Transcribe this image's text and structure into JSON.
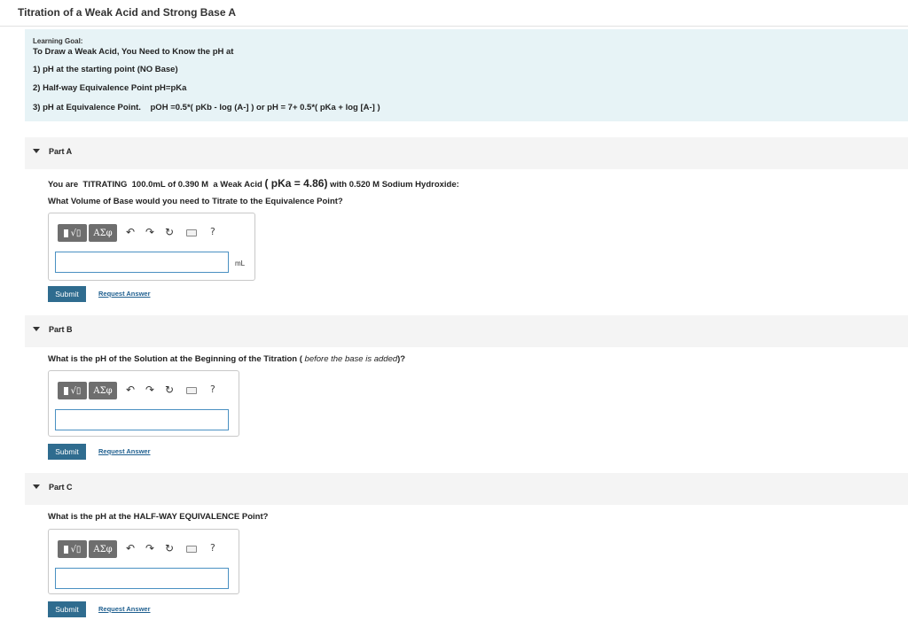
{
  "page": {
    "title": "Titration of a Weak Acid and Strong Base A"
  },
  "learning_goal": {
    "label": "Learning Goal:",
    "lines": [
      "To Draw a Weak Acid, You Need to Know the pH at",
      "1) pH at the starting point (NO Base)",
      "2) Half-way Equivalence Point pH=pKa",
      "3) pH at Equivalence Point.    pOH =0.5*( pKb - log (A-] ) or pH = 7+ 0.5*( pKa + log [A-] )"
    ]
  },
  "toolbar": {
    "template_symbol": "√▯",
    "greek_symbol": "ΑΣφ",
    "undo_glyph": "↶",
    "redo_glyph": "↷",
    "reset_glyph": "↻",
    "help_glyph": "?"
  },
  "parts": [
    {
      "label": "Part A",
      "question_pre": "You are  TITRATING  100.0mL of 0.390 M  a Weak Acid",
      "question_pka": "( pKa = 4.86)",
      "question_post": "with 0.520  M Sodium Hydroxide:",
      "question2": "What Volume of Base would you need to Titrate to the Equivalence Point?",
      "input_value": "",
      "unit": "mL",
      "submit_label": "Submit",
      "request_label": "Request Answer"
    },
    {
      "label": "Part B",
      "question": "What is the pH of the Solution at the Beginning of the Titration (",
      "question_italic": " before the base is added",
      "question_end": ")?",
      "input_value": "",
      "submit_label": "Submit",
      "request_label": "Request Answer"
    },
    {
      "label": "Part C",
      "question": "What is the pH at the HALF-WAY EQUIVALENCE Point?",
      "input_value": "",
      "submit_label": "Submit",
      "request_label": "Request Answer"
    }
  ]
}
